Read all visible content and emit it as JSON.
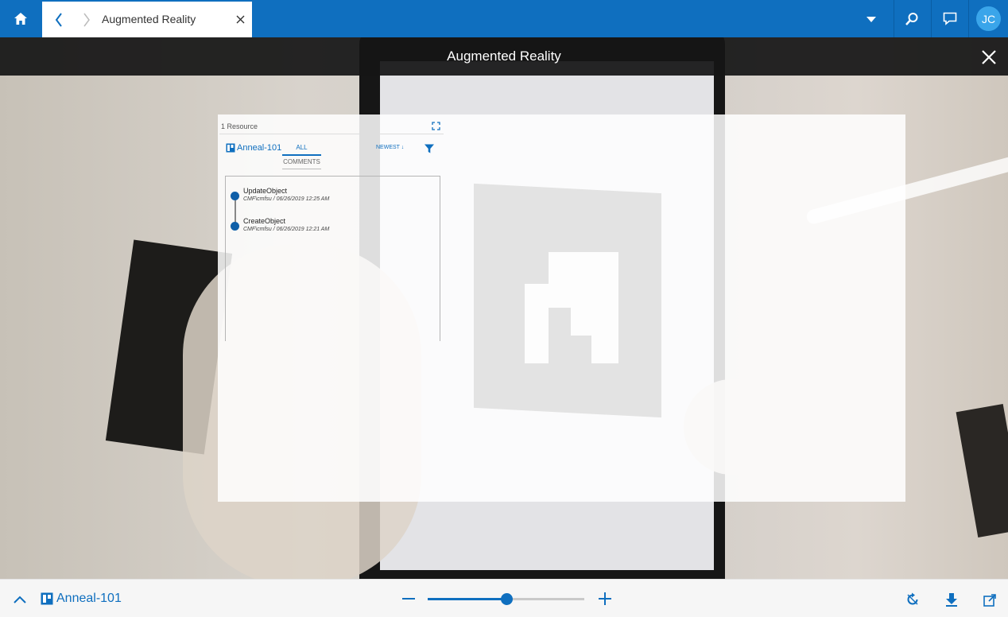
{
  "topbar": {
    "tab_title": "Augmented Reality",
    "avatar_initials": "JC",
    "icons": {
      "home": "home-icon",
      "back": "chevron-left-icon",
      "forward": "chevron-right-icon",
      "close": "close-icon",
      "dropdown": "caret-down-icon",
      "search": "search-icon",
      "chat": "chat-icon"
    },
    "color": "#0f6fbf"
  },
  "ar_header": {
    "title": "Augmented Reality",
    "close_icon": "close-icon"
  },
  "ar_panel": {
    "resource_count": "1 Resource",
    "resource_name": "Anneal-101",
    "tabs": [
      {
        "label": "ALL",
        "active": true
      },
      {
        "label": "COMMENTS",
        "active": false
      }
    ],
    "sort_label": "NEWEST ↓",
    "history": [
      {
        "title": "UpdateObject",
        "meta": "CMF\\cmfsu / 06/26/2019 12:25 AM"
      },
      {
        "title": "CreateObject",
        "meta": "CMF\\cmfsu / 06/26/2019 12:21 AM"
      }
    ]
  },
  "bottombar": {
    "resource_name": "Anneal-101",
    "zoom_level": 0.5,
    "icons": {
      "collapse": "chevron-up-icon",
      "zoom_out": "minus-icon",
      "zoom_in": "plus-icon",
      "refresh": "refresh-icon",
      "download": "download-icon",
      "popout": "popout-icon"
    }
  },
  "colors": {
    "accent": "#0f6fbf",
    "dark_bar": "#161616"
  }
}
